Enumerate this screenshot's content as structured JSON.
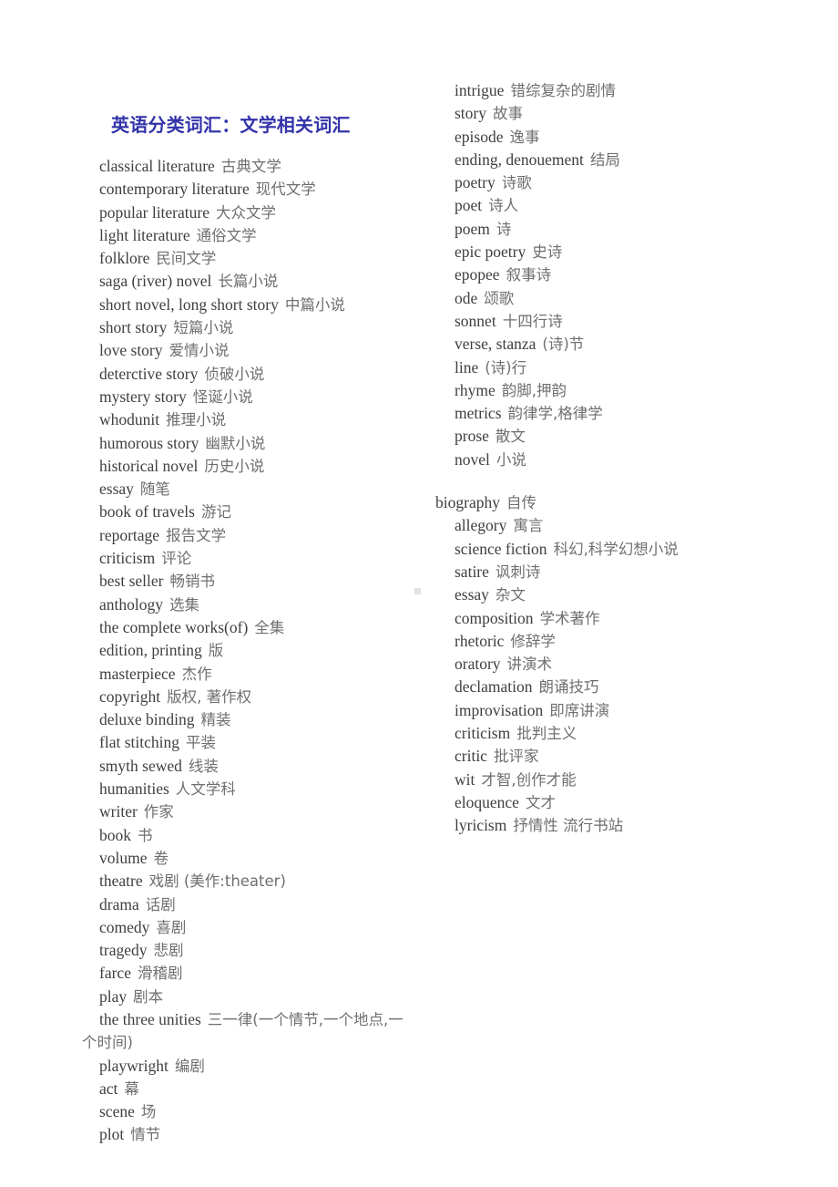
{
  "document": {
    "title": "英语分类词汇：文学相关词汇",
    "title_color": "#3333aa",
    "background_color": "#ffffff",
    "text_color": "#4a4a4a"
  },
  "left_column": {
    "entries": [
      {
        "en": "classical literature",
        "zh": "古典文学"
      },
      {
        "en": "contemporary literature",
        "zh": "现代文学"
      },
      {
        "en": "popular literature",
        "zh": "大众文学"
      },
      {
        "en": "light literature",
        "zh": "通俗文学"
      },
      {
        "en": "folklore",
        "zh": "民间文学"
      },
      {
        "en": "saga (river) novel",
        "zh": "长篇小说"
      },
      {
        "en": "short novel, long short story",
        "zh": "中篇小说"
      },
      {
        "en": "short story",
        "zh": "短篇小说"
      },
      {
        "en": "love story",
        "zh": "爱情小说"
      },
      {
        "en": "deterctive story",
        "zh": "侦破小说"
      },
      {
        "en": "mystery story",
        "zh": "怪诞小说"
      },
      {
        "en": "whodunit",
        "zh": "推理小说"
      },
      {
        "en": "humorous story",
        "zh": "幽默小说"
      },
      {
        "en": "historical novel",
        "zh": "历史小说"
      },
      {
        "en": "essay",
        "zh": "随笔"
      },
      {
        "en": "book of travels",
        "zh": "游记"
      },
      {
        "en": "reportage",
        "zh": "报告文学"
      },
      {
        "en": "criticism",
        "zh": "评论"
      },
      {
        "en": "best seller",
        "zh": "畅销书"
      },
      {
        "en": "anthology",
        "zh": "选集"
      },
      {
        "en": "the complete works(of)",
        "zh": "全集"
      },
      {
        "en": "edition, printing",
        "zh": "版"
      },
      {
        "en": "masterpiece",
        "zh": "杰作"
      },
      {
        "en": "copyright",
        "zh": "版权, 著作权"
      },
      {
        "en": "deluxe binding",
        "zh": "精装"
      },
      {
        "en": "flat stitching",
        "zh": "平装"
      },
      {
        "en": "smyth sewed",
        "zh": "线装"
      },
      {
        "en": "humanities",
        "zh": "人文学科"
      },
      {
        "en": "writer",
        "zh": "作家"
      },
      {
        "en": "book",
        "zh": "书"
      },
      {
        "en": "volume",
        "zh": "卷"
      },
      {
        "en": "theatre",
        "zh": "戏剧 (美作:theater)"
      },
      {
        "en": "drama",
        "zh": "话剧"
      },
      {
        "en": "comedy",
        "zh": "喜剧"
      },
      {
        "en": "tragedy",
        "zh": "悲剧"
      },
      {
        "en": "farce",
        "zh": "滑稽剧"
      },
      {
        "en": "play",
        "zh": "剧本"
      },
      {
        "en": "the three unities",
        "zh": "三一律(一个情节,一个地点,一个时间)"
      },
      {
        "en": "playwright",
        "zh": "编剧"
      },
      {
        "en": "act",
        "zh": "幕"
      },
      {
        "en": "scene",
        "zh": "场"
      },
      {
        "en": "plot",
        "zh": "情节"
      }
    ]
  },
  "right_column": {
    "group_one": [
      {
        "en": "intrigue",
        "zh": "错综复杂的剧情"
      },
      {
        "en": "story",
        "zh": "故事"
      },
      {
        "en": "episode",
        "zh": "逸事"
      },
      {
        "en": "ending, denouement",
        "zh": "结局"
      },
      {
        "en": "poetry",
        "zh": "诗歌"
      },
      {
        "en": "poet",
        "zh": "诗人"
      },
      {
        "en": "poem",
        "zh": "诗"
      },
      {
        "en": "epic poetry",
        "zh": "史诗"
      },
      {
        "en": "epopee",
        "zh": "叙事诗"
      },
      {
        "en": "ode",
        "zh": "颂歌"
      },
      {
        "en": "sonnet",
        "zh": "十四行诗"
      },
      {
        "en": "verse, stanza",
        "zh": "(诗)节"
      },
      {
        "en": "line",
        "zh": "(诗)行"
      },
      {
        "en": "rhyme",
        "zh": "韵脚,押韵"
      },
      {
        "en": "metrics",
        "zh": "韵律学,格律学"
      },
      {
        "en": "prose",
        "zh": "散文"
      },
      {
        "en": "novel",
        "zh": "小说"
      }
    ],
    "group_two_lead": {
      "en": "biography",
      "zh": "自传"
    },
    "group_two": [
      {
        "en": "allegory",
        "zh": "寓言"
      },
      {
        "en": "science fiction",
        "zh": "科幻,科学幻想小说"
      },
      {
        "en": "satire",
        "zh": "讽刺诗"
      },
      {
        "en": "essay",
        "zh": "杂文"
      },
      {
        "en": "composition",
        "zh": "学术著作"
      },
      {
        "en": "rhetoric",
        "zh": "修辞学"
      },
      {
        "en": "oratory",
        "zh": "讲演术"
      },
      {
        "en": "declamation",
        "zh": "朗诵技巧"
      },
      {
        "en": "improvisation",
        "zh": "即席讲演"
      },
      {
        "en": "criticism",
        "zh": "批判主义"
      },
      {
        "en": "critic",
        "zh": "批评家"
      },
      {
        "en": "wit",
        "zh": "才智,创作才能"
      },
      {
        "en": "eloquence",
        "zh": "文才"
      },
      {
        "en": "lyricism",
        "zh": "抒情性 流行书站"
      }
    ]
  }
}
